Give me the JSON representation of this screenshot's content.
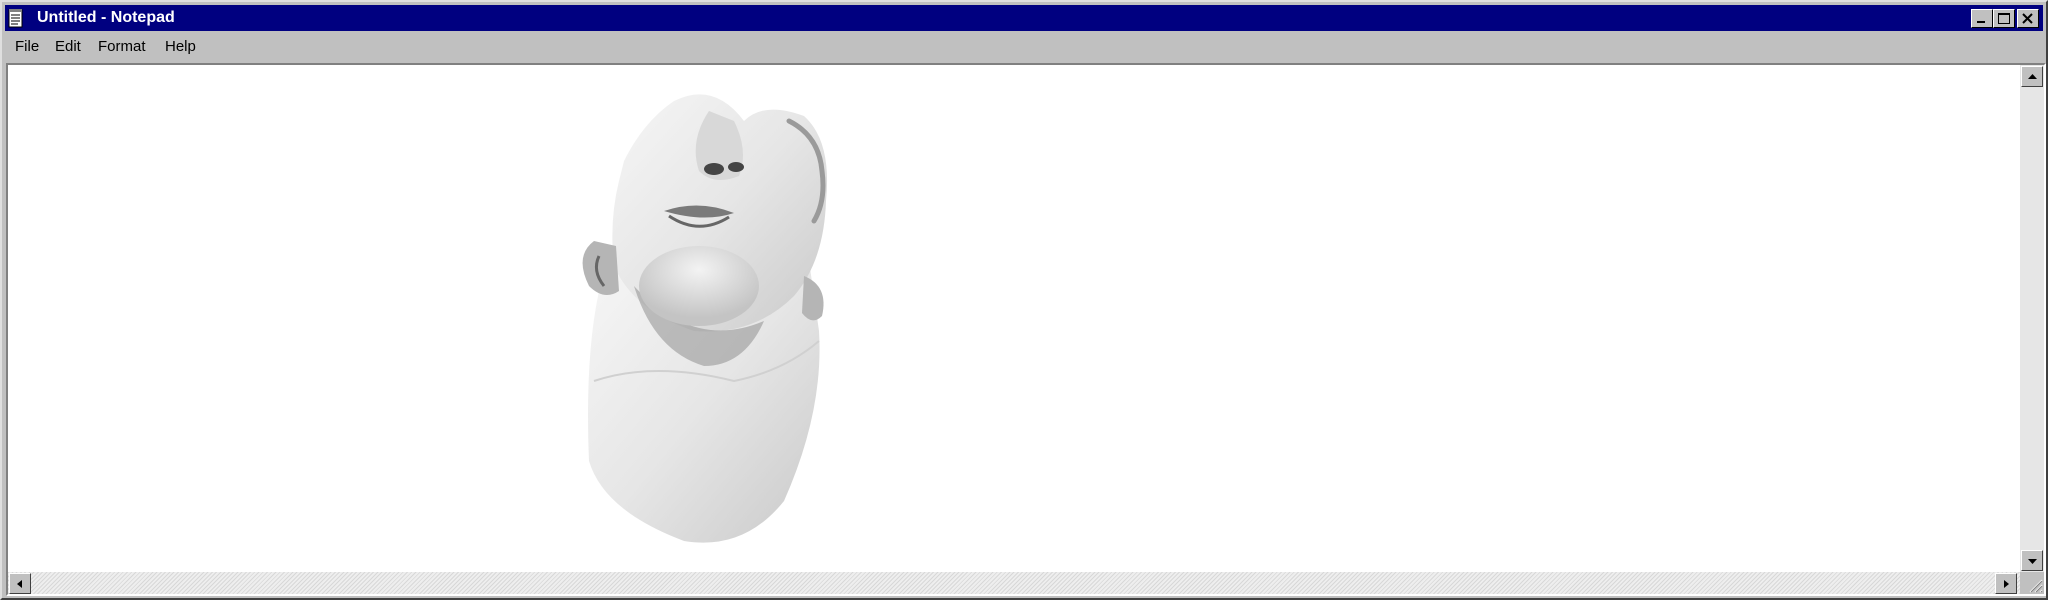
{
  "window": {
    "title": "Untitled - Notepad",
    "title_bar_color": "#000080",
    "frame_color": "#c0c0c0",
    "controls": [
      "minimize-icon",
      "maximize-icon",
      "close-icon"
    ]
  },
  "menu": {
    "items": [
      {
        "label": "File"
      },
      {
        "label": "Edit"
      },
      {
        "label": "Format"
      },
      {
        "label": "Help"
      }
    ]
  },
  "editor": {
    "text": "",
    "background": "#ffffff",
    "content": "marble-statue-head-image"
  },
  "scrollbars": {
    "vertical": [
      "scroll-up-arrow-icon",
      "scroll-down-arrow-icon"
    ],
    "horizontal": [
      "scroll-left-arrow-icon",
      "scroll-right-arrow-icon"
    ]
  }
}
